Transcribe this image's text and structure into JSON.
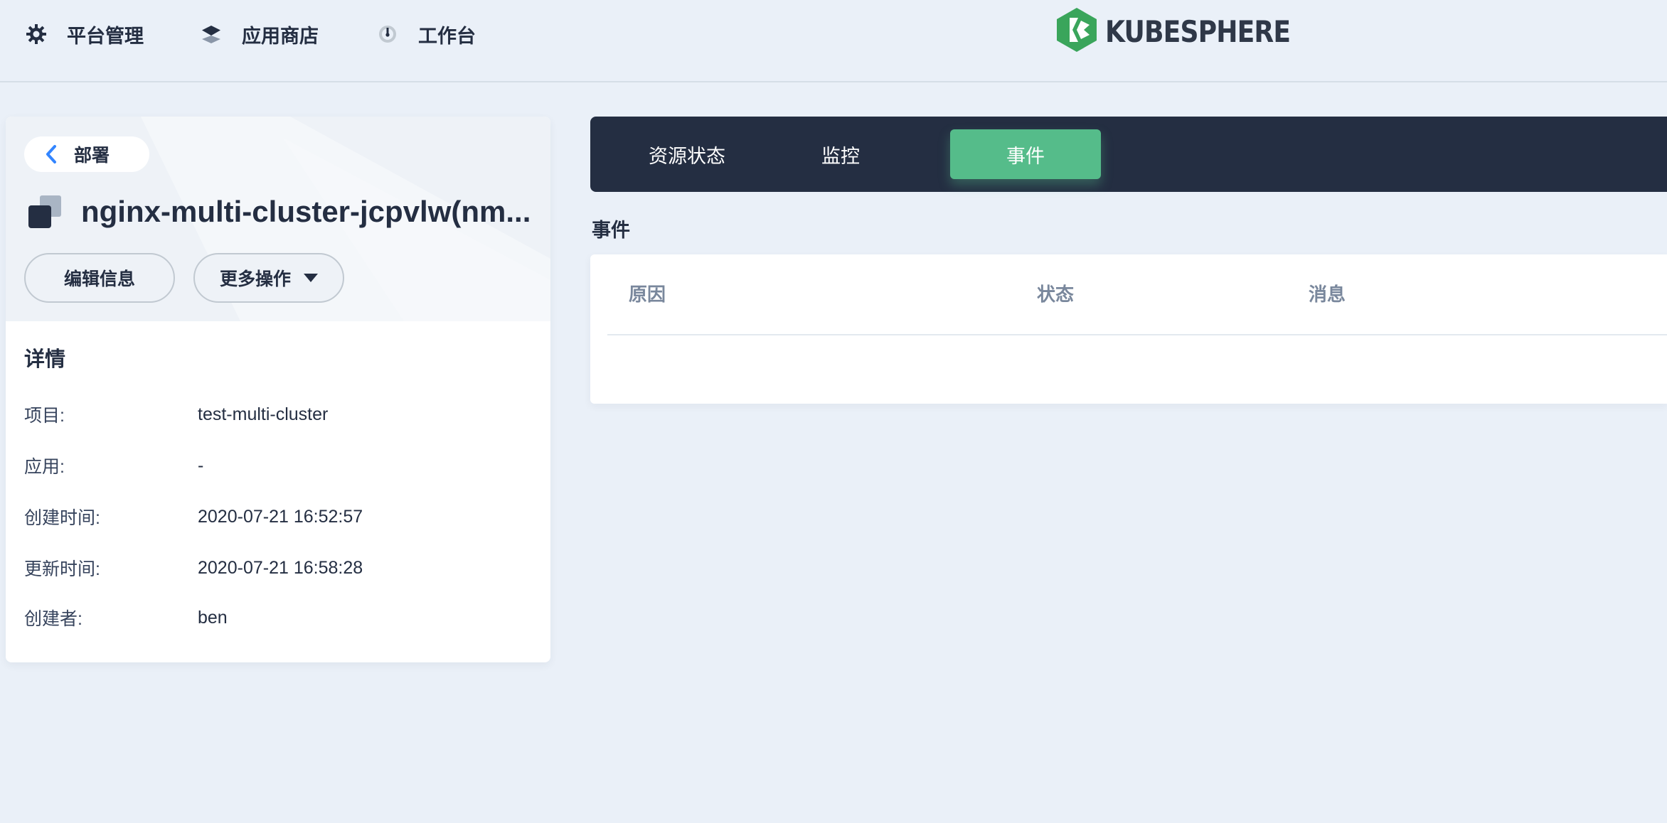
{
  "nav": {
    "items": [
      {
        "label": "平台管理",
        "icon": "gear-icon"
      },
      {
        "label": "应用商店",
        "icon": "layers-icon"
      },
      {
        "label": "工作台",
        "icon": "dashboard-icon"
      }
    ],
    "logo_text": "KUBESPHERE"
  },
  "resource": {
    "back_label": "部署",
    "name": "nginx-multi-cluster-jcpvlw(nm...",
    "edit_label": "编辑信息",
    "more_label": "更多操作"
  },
  "details": {
    "title": "详情",
    "rows": [
      {
        "key": "项目:",
        "value": "test-multi-cluster"
      },
      {
        "key": "应用:",
        "value": "-"
      },
      {
        "key": "创建时间:",
        "value": "2020-07-21 16:52:57"
      },
      {
        "key": "更新时间:",
        "value": "2020-07-21 16:58:28"
      },
      {
        "key": "创建者:",
        "value": "ben"
      }
    ]
  },
  "tabs": [
    {
      "label": "资源状态",
      "active": false
    },
    {
      "label": "监控",
      "active": false
    },
    {
      "label": "事件",
      "active": true
    }
  ],
  "events": {
    "section_label": "事件",
    "columns": [
      "原因",
      "状态",
      "消息"
    ]
  },
  "colors": {
    "accent": "#55bc8a",
    "dark": "#242e42",
    "background": "#eaf0f8",
    "logo_green": "#3aa55b"
  }
}
